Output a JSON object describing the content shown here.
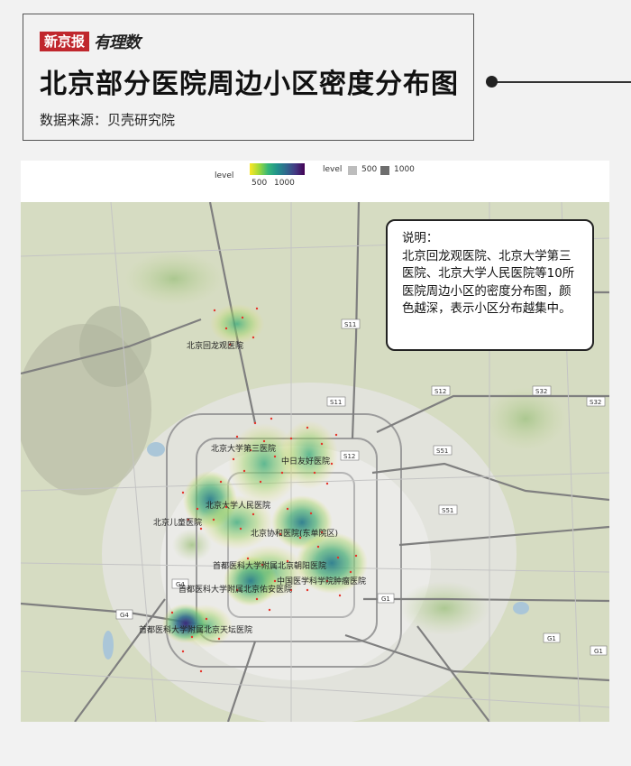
{
  "brand": {
    "name": "新京报",
    "column": "有理数"
  },
  "title": "北京部分医院周边小区密度分布图",
  "source": "数据来源：贝壳研究院",
  "legend": {
    "continuous": {
      "label": "level",
      "ticks": [
        "500",
        "1000"
      ]
    },
    "gray": {
      "label": "level",
      "items": [
        "500",
        "1000"
      ]
    }
  },
  "note": {
    "heading": "说明：",
    "body": "北京回龙观医院、北京大学第三医院、北京大学人民医院等10所医院周边小区的密度分布图，颜色越深，表示小区分布越集中。"
  },
  "hospitals": [
    "北京回龙观医院",
    "北京大学第三医院",
    "中日友好医院",
    "北京大学人民医院",
    "北京儿童医院",
    "北京协和医院(东单院区)",
    "首都医科大学附属北京朝阳医院",
    "中国医学科学院肿瘤医院",
    "首都医科大学附属北京佑安医院",
    "首都医科大学附属北京天坛医院"
  ],
  "road_labels": [
    "S11",
    "S11",
    "S12",
    "S32",
    "S32",
    "S12",
    "S51",
    "S51",
    "G1",
    "G1",
    "G1",
    "G4",
    "G4"
  ],
  "colors": {
    "accent_red": "#c0272d",
    "density_low": "#fde725",
    "density_mid": "#35b779",
    "density_high": "#440154"
  }
}
